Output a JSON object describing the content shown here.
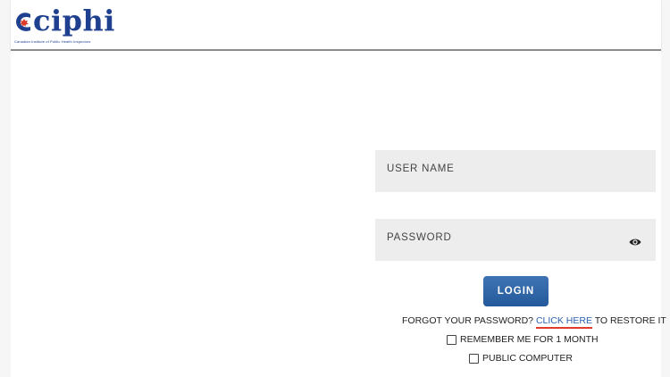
{
  "header": {
    "logo_text": "ciphi",
    "logo_subtitle": "Canadian Institute of Public Health Inspectors"
  },
  "form": {
    "username_label": "USER NAME",
    "password_label": "PASSWORD",
    "login_label": "LOGIN",
    "forgot_prefix": "FORGOT YOUR PASSWORD? ",
    "forgot_link": "CLICK HERE",
    "forgot_suffix": " TO RESTORE IT",
    "remember_label": "REMEMBER ME FOR 1 MONTH",
    "public_label": "PUBLIC COMPUTER"
  },
  "icons": {
    "password_toggle": "eye-icon",
    "logo_mark": "maple-leaf-icon"
  },
  "colors": {
    "brand": "#1f3f8f",
    "button": "#2d63a5",
    "link": "#2a5fb0",
    "link_underline": "#e23b2e",
    "field_bg": "#ededed"
  }
}
